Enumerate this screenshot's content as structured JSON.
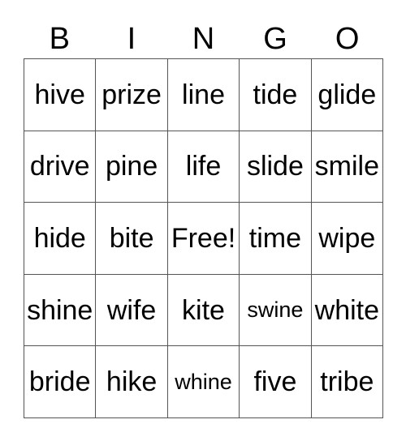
{
  "card": {
    "headers": [
      "B",
      "I",
      "N",
      "G",
      "O"
    ],
    "rows": [
      [
        {
          "text": "hive",
          "fit": "normal"
        },
        {
          "text": "prize",
          "fit": "normal"
        },
        {
          "text": "line",
          "fit": "normal"
        },
        {
          "text": "tide",
          "fit": "normal"
        },
        {
          "text": "glide",
          "fit": "normal"
        }
      ],
      [
        {
          "text": "drive",
          "fit": "normal"
        },
        {
          "text": "pine",
          "fit": "normal"
        },
        {
          "text": "life",
          "fit": "normal"
        },
        {
          "text": "slide",
          "fit": "normal"
        },
        {
          "text": "smile",
          "fit": "normal"
        }
      ],
      [
        {
          "text": "hide",
          "fit": "normal"
        },
        {
          "text": "bite",
          "fit": "normal"
        },
        {
          "text": "Free!",
          "fit": "normal"
        },
        {
          "text": "time",
          "fit": "normal"
        },
        {
          "text": "wipe",
          "fit": "normal"
        }
      ],
      [
        {
          "text": "shine",
          "fit": "normal"
        },
        {
          "text": "wife",
          "fit": "normal"
        },
        {
          "text": "kite",
          "fit": "normal"
        },
        {
          "text": "swine",
          "fit": "shrink"
        },
        {
          "text": "white",
          "fit": "normal"
        }
      ],
      [
        {
          "text": "bride",
          "fit": "normal"
        },
        {
          "text": "hike",
          "fit": "normal"
        },
        {
          "text": "whine",
          "fit": "shrink"
        },
        {
          "text": "five",
          "fit": "normal"
        },
        {
          "text": "tribe",
          "fit": "normal"
        }
      ]
    ],
    "colors": {
      "background": "#ffffff",
      "text": "#000000",
      "grid_line": "#555555"
    }
  }
}
